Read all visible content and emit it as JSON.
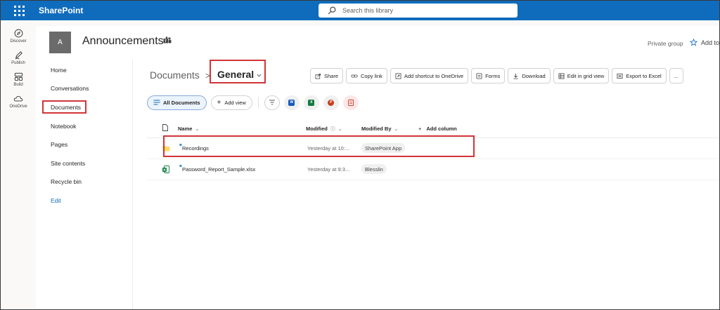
{
  "topbar": {
    "app_name": "SharePoint",
    "search_placeholder": "Search this library",
    "bg_color": "#0f6cbd"
  },
  "rail": {
    "items": [
      {
        "label": "Discover",
        "icon": "compass-icon"
      },
      {
        "label": "Publish",
        "icon": "pen-icon"
      },
      {
        "label": "Build",
        "icon": "build-icon"
      },
      {
        "label": "OneDrive",
        "icon": "cloud-icon"
      }
    ]
  },
  "site": {
    "logo_letter": "A",
    "title": "Announcements",
    "privacy": "Private group",
    "add_to": "Add to"
  },
  "sitenav": {
    "items": [
      "Home",
      "Conversations",
      "Documents",
      "Notebook",
      "Pages",
      "Site contents",
      "Recycle bin",
      "Edit"
    ],
    "selected": "Documents"
  },
  "breadcrumb": {
    "library": "Documents",
    "separator": ">",
    "folder": "General"
  },
  "commands": [
    {
      "label": "Share",
      "icon": "share-icon"
    },
    {
      "label": "Copy link",
      "icon": "link-icon"
    },
    {
      "label": "Add shortcut to OneDrive",
      "icon": "shortcut-icon"
    },
    {
      "label": "Forms",
      "icon": "forms-icon"
    },
    {
      "label": "Download",
      "icon": "download-icon"
    },
    {
      "label": "Edit in grid view",
      "icon": "grid-icon"
    },
    {
      "label": "Export to Excel",
      "icon": "excel-export-icon"
    },
    {
      "label": "...",
      "icon": "more-icon"
    }
  ],
  "views": {
    "current": "All Documents",
    "add_view": "Add view"
  },
  "table": {
    "columns": {
      "name": "Name",
      "modified": "Modified",
      "modified_by": "Modified By",
      "add_column": "Add column"
    },
    "rows": [
      {
        "type": "folder",
        "name": "Recordings",
        "modified": "Yesterday at 10:...",
        "modified_by": "SharePoint App"
      },
      {
        "type": "xlsx",
        "name": "Password_Report_Sample.xlsx",
        "modified": "Yesterday at 9:3...",
        "modified_by": "Blesslin"
      }
    ]
  },
  "colors": {
    "accent": "#0f6cbd",
    "highlight_box": "#d13438",
    "folder": "#f7c948",
    "excel": "#107c41"
  }
}
